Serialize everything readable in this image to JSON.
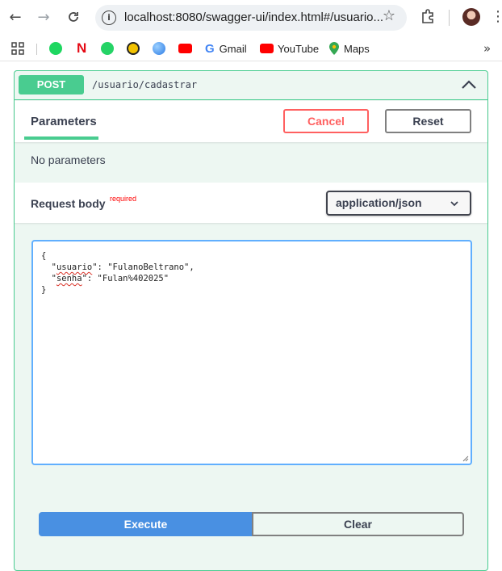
{
  "browser": {
    "url": "localhost:8080/swagger-ui/index.html#/usuario...",
    "bookmarks": [
      {
        "label": "",
        "icon": "spotify-icon",
        "color": "#1ed760"
      },
      {
        "label": "",
        "icon": "netflix-icon",
        "color": "#e50914"
      },
      {
        "label": "",
        "icon": "whatsapp-icon",
        "color": "#25d366"
      },
      {
        "label": "",
        "icon": "bee-icon",
        "color": "#f2c200"
      },
      {
        "label": "",
        "icon": "globe-icon",
        "color": "#2c7be5"
      },
      {
        "label": "",
        "icon": "youtube-icon",
        "color": "#ff0000"
      },
      {
        "label": "Gmail",
        "icon": "google-icon",
        "color": "#4285f4"
      },
      {
        "label": "YouTube",
        "icon": "youtube-icon",
        "color": "#ff0000"
      },
      {
        "label": "Maps",
        "icon": "maps-pin-icon",
        "color": "#34a853"
      }
    ]
  },
  "operation": {
    "method": "POST",
    "path": "/usuario/cadastrar",
    "color": "#49cc90"
  },
  "parameters": {
    "tab_label": "Parameters",
    "cancel_label": "Cancel",
    "reset_label": "Reset",
    "empty_text": "No parameters"
  },
  "request_body": {
    "label": "Request body",
    "required_label": "required",
    "content_type": "application/json",
    "json": {
      "open": "{",
      "usuario_key": "usuario",
      "usuario_value": "FulanoBeltrano",
      "senha_key": "senha",
      "senha_value": "Fulan%402025",
      "close": "}"
    }
  },
  "actions": {
    "execute_label": "Execute",
    "clear_label": "Clear"
  }
}
